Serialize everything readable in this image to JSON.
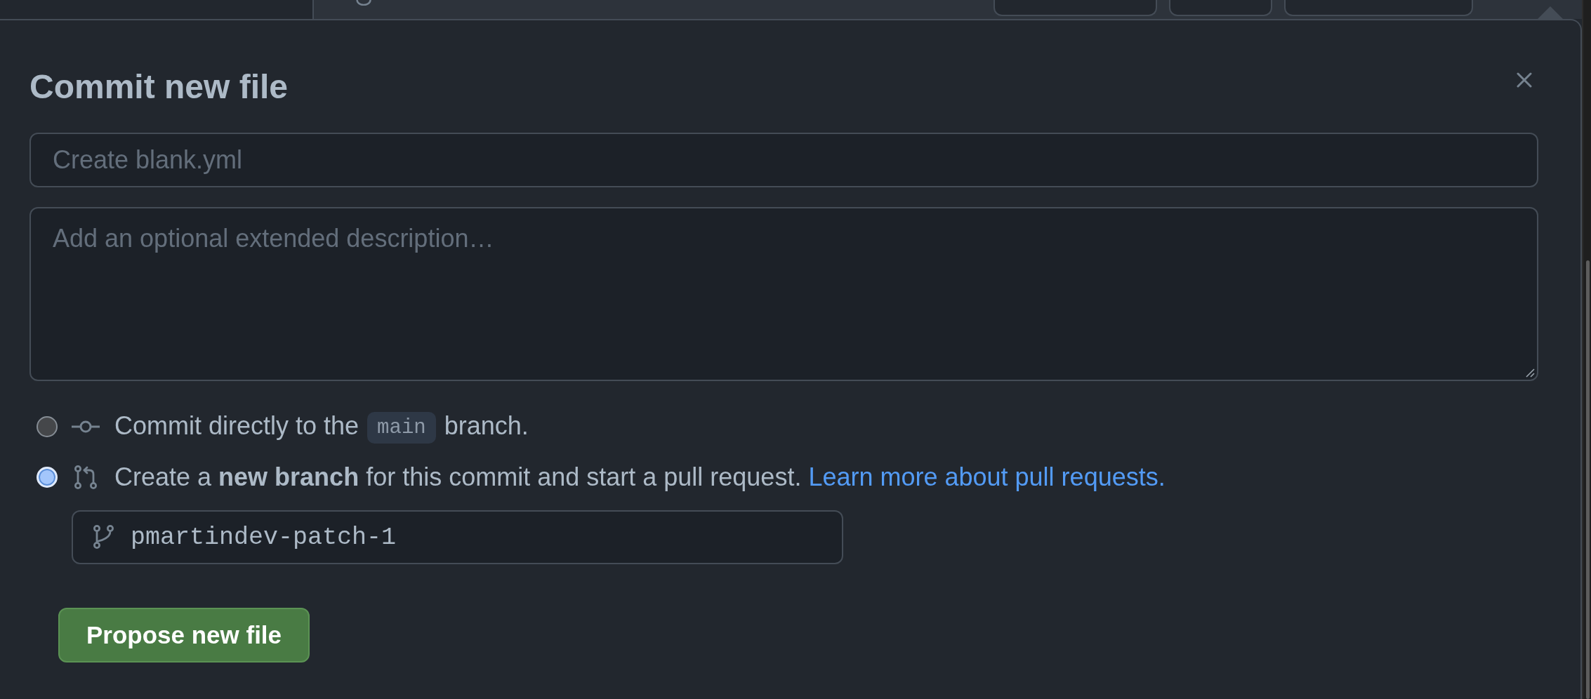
{
  "dialog": {
    "title": "Commit new file",
    "commit_message": {
      "placeholder": "Create blank.yml"
    },
    "description": {
      "placeholder": "Add an optional extended description…"
    },
    "options": [
      {
        "kind": "direct",
        "selected": false,
        "text": "Commit directly to the",
        "branch": "main",
        "text_after": "branch."
      },
      {
        "kind": "new_branch",
        "selected": true,
        "text": "Create a **new branch** for this commit and start a pull request.",
        "link": "Learn more about pull requests."
      }
    ],
    "branch_name": {
      "value": "pmartindev-patch-1"
    },
    "submit_button": "Propose new file"
  }
}
